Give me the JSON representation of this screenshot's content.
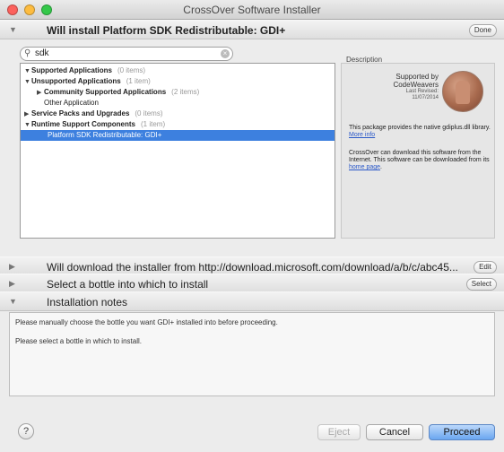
{
  "window": {
    "title": "CrossOver Software Installer"
  },
  "install_section": {
    "title": "Will install Platform SDK Redistributable: GDI+",
    "button": "Done"
  },
  "search": {
    "value": "sdk"
  },
  "tree": [
    {
      "label": "Supported Applications",
      "count": "(0 items)",
      "arrow": "▼",
      "bold": true,
      "selected": false
    },
    {
      "label": "Unsupported Applications",
      "count": "(1 item)",
      "arrow": "▼",
      "bold": true,
      "selected": false
    },
    {
      "label": "Community Supported Applications",
      "count": "(2 items)",
      "arrow": "▶",
      "bold": true,
      "selected": false
    },
    {
      "label": "Other Application",
      "count": "",
      "arrow": "",
      "bold": false,
      "selected": false
    },
    {
      "label": "Service Packs and Upgrades",
      "count": "(0 items)",
      "arrow": "▶",
      "bold": true,
      "selected": false
    },
    {
      "label": "Runtime Support Components",
      "count": "(1 item)",
      "arrow": "▼",
      "bold": true,
      "selected": false
    },
    {
      "label": "Platform SDK Redistributable: GDI+",
      "count": "",
      "arrow": "",
      "bold": false,
      "selected": true
    }
  ],
  "description": {
    "heading": "Description",
    "supported_by": "Supported by",
    "vendor": "CodeWeavers",
    "last_revised_label": "Last Revised:",
    "last_revised_date": "11/07/2014",
    "para1": "This package provides the native gdiplus.dll library.",
    "para1_link": "More info",
    "para2": "CrossOver can download this software from the Internet. This software can be downloaded from its",
    "para2_link": "home page"
  },
  "download_section": {
    "title": "Will download the installer from http://download.microsoft.com/download/a/b/c/abc45...",
    "button": "Edit"
  },
  "bottle_section": {
    "title": "Select a bottle into which to install",
    "button": "Select"
  },
  "notes_section": {
    "title": "Installation notes",
    "lines": [
      "Please manually choose the bottle you want GDI+ installed into before proceeding.",
      "Please select a bottle in which to install."
    ]
  },
  "footer": {
    "help": "?",
    "eject": "Eject",
    "cancel": "Cancel",
    "proceed": "Proceed"
  }
}
